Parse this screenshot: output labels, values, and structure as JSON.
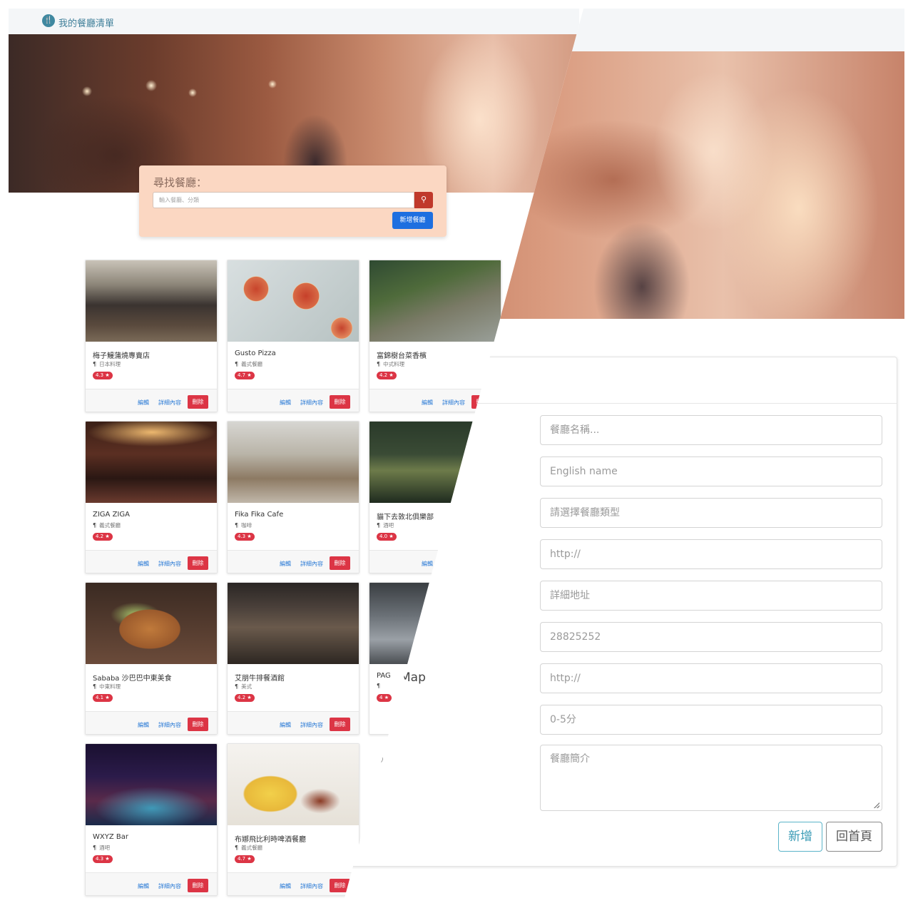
{
  "list_page": {
    "brand": "我的餐廳清單",
    "search_title": "尋找餐廳：",
    "search_placeholder": "輸入餐廳、分類",
    "new_button": "新增餐廳",
    "actions": {
      "edit": "編輯",
      "detail": "詳細內容",
      "delete": "刪除"
    },
    "restaurants": [
      {
        "name": "梅子鰻蒲燒專賣店",
        "category": "日本料理",
        "rating": "4.3"
      },
      {
        "name": "Gusto Pizza",
        "category": "義式餐廳",
        "rating": "4.7"
      },
      {
        "name": "富錦樹台菜香檳",
        "category": "中式料理",
        "rating": "4.2"
      },
      {
        "name": "ZIGA ZIGA",
        "category": "義式餐廳",
        "rating": "4.2"
      },
      {
        "name": "Fika Fika Cafe",
        "category": "咖啡",
        "rating": "4.3"
      },
      {
        "name": "貓下去敦北俱樂部",
        "category": "酒吧",
        "rating": "4.0"
      },
      {
        "name": "Sababa 沙巴巴中東美食",
        "category": "中東料理",
        "rating": "4.1"
      },
      {
        "name": "艾朋牛排餐酒館",
        "category": "美式",
        "rating": "4.2"
      },
      {
        "name": "PAG",
        "category": "",
        "rating": "4"
      },
      {
        "name": "WXYZ Bar",
        "category": "酒吧",
        "rating": "4.3"
      },
      {
        "name": "布娜飛比利時啤酒餐廳",
        "category": "義式餐廳",
        "rating": "4.7"
      }
    ]
  },
  "form_page": {
    "map_label": "Map",
    "fields": {
      "name": "餐廳名稱...",
      "english_name": "English name",
      "category": "請選擇餐廳類型",
      "image_url": "http://",
      "location": "詳細地址",
      "phone": "28825252",
      "google_map": "http://",
      "rating": "0-5分",
      "description": "餐廳簡介"
    },
    "add_button": "新增",
    "home_button": "回首頁"
  },
  "colors": {
    "accent": "#3a9bb5",
    "danger": "#dc3545",
    "primary": "#1e6fe0",
    "panel": "#fbd7c2"
  }
}
